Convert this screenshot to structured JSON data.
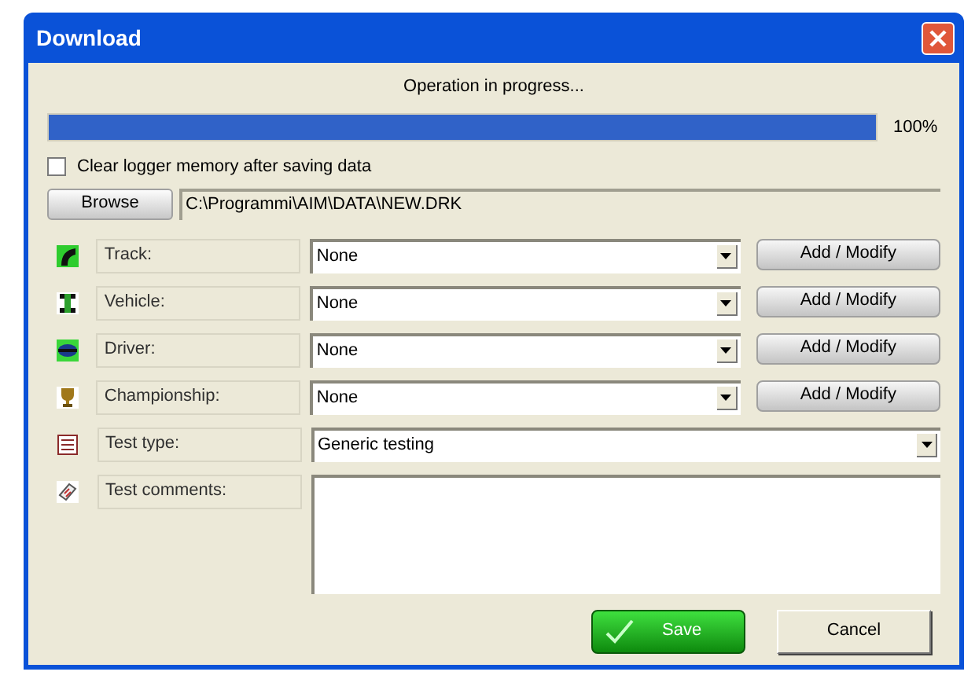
{
  "window": {
    "title": "Download"
  },
  "status": "Operation in progress...",
  "progress": {
    "level": 1,
    "reading": "100%"
  },
  "clear_memory": {
    "label": "Clear logger memory after saving data",
    "checked": false
  },
  "browse": {
    "button": "Browse",
    "path": "C:\\Programmi\\AIM\\DATA\\NEW.DRK"
  },
  "fields": [
    {
      "kind": "combo",
      "label": "Track:",
      "value": "None",
      "button": "Add / Modify"
    },
    {
      "kind": "combo",
      "label": "Vehicle:",
      "value": "None",
      "button": "Add / Modify"
    },
    {
      "kind": "combo",
      "label": "Driver:",
      "value": "None",
      "button": "Add / Modify"
    },
    {
      "kind": "combo",
      "label": "Championship:",
      "value": "None",
      "button": "Add / Modify"
    },
    {
      "kind": "combo",
      "label": "Test type:",
      "value": "Generic testing"
    },
    {
      "kind": "text",
      "label": "Test comments:"
    }
  ],
  "buttons": [
    {
      "kind": "primary",
      "label": "Save"
    },
    {
      "kind": "normal",
      "label": "Cancel"
    }
  ]
}
